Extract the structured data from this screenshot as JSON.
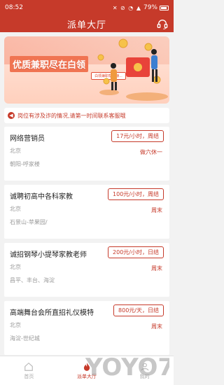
{
  "status_bar": {
    "time": "08:52",
    "battery": "79%"
  },
  "header": {
    "title": "派单大厅",
    "icon": "headset-icon"
  },
  "banner": {
    "title": "优质兼职尽在白领",
    "badge": "白领兼职帮你赚..."
  },
  "notice": {
    "text": "岗位有涉及诈的情况,请第一时间联系客服哦"
  },
  "jobs": [
    {
      "title": "网络营销员",
      "pay": "17元/小时，周结",
      "city": "北京",
      "time": "做六休一",
      "area": "朝阳-呼家楼"
    },
    {
      "title": "诚聘初高中各科家教",
      "pay": "100元/小时，周结",
      "city": "北京",
      "time": "周末",
      "area": "石景山-苹果园/"
    },
    {
      "title": "诚招钢琴小提琴家教老师",
      "pay": "200元/小时，日结",
      "city": "北京",
      "time": "周末",
      "area": "昌平、丰台、海淀"
    },
    {
      "title": "高端舞台会所直招礼仪模特",
      "pay": "800元/天，日结",
      "city": "北京",
      "time": "周末",
      "area": "海淀-世纪城"
    }
  ],
  "tabbar": [
    {
      "label": "首页",
      "icon": "home-icon"
    },
    {
      "label": "派单大厅",
      "icon": "fire-icon"
    },
    {
      "label": "我的",
      "icon": "user-icon"
    }
  ],
  "watermark": {
    "text": "YOYO7"
  }
}
